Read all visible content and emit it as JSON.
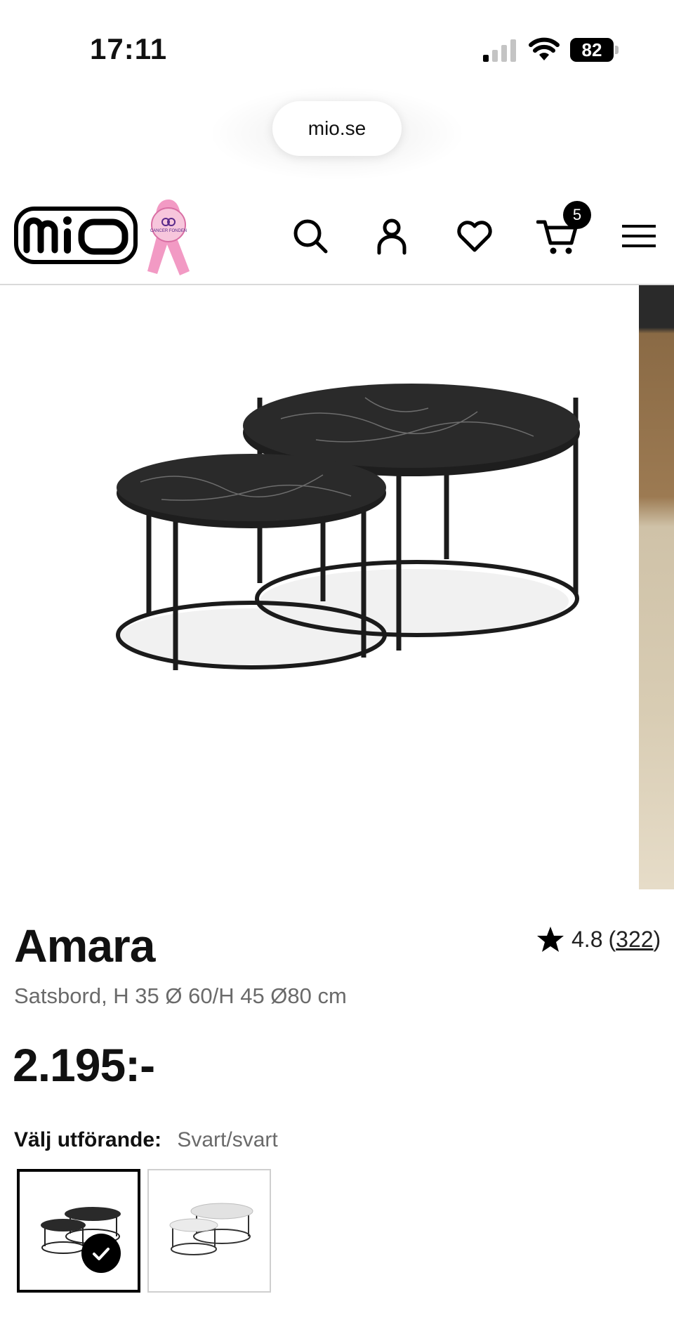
{
  "status_bar": {
    "time": "17:11",
    "battery": "82"
  },
  "browser": {
    "url": "mio.se"
  },
  "header": {
    "logo_text": "mio",
    "ribbon_text": "CANCER FONDEN",
    "cart_count": "5",
    "icons": [
      "search-icon",
      "account-icon",
      "heart-icon",
      "cart-icon",
      "menu-icon"
    ]
  },
  "product": {
    "name": "Amara",
    "rating_value": "4.8",
    "rating_open": "(",
    "rating_count": "322",
    "rating_close": ")",
    "subtitle": "Satsbord, H 35 Ø 60/H 45 Ø80 cm",
    "price": "2.195:-",
    "variant_label": "Välj utförande:",
    "variant_value": "Svart/svart"
  },
  "colors": {
    "brand_black": "#000000",
    "ribbon_pink": "#f29ac4",
    "muted_text": "#6a6a6a"
  }
}
